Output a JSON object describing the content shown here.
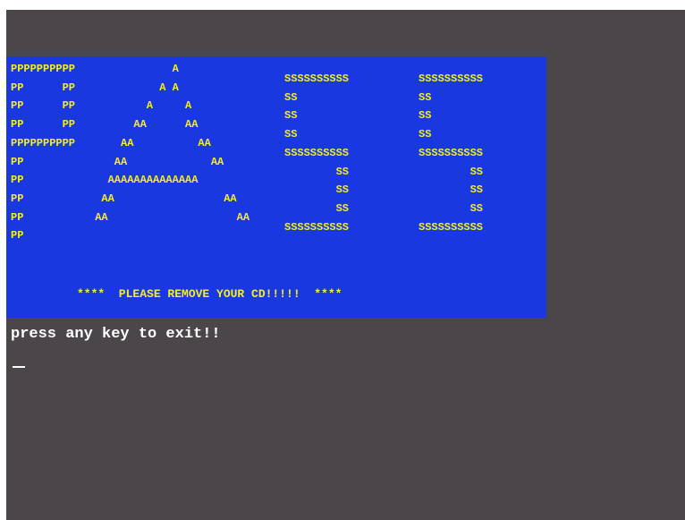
{
  "banner": {
    "letter_p": "PPPPPPPPPP\nPP      PP\nPP      PP\nPP      PP\nPPPPPPPPPP\nPP\nPP\nPP\nPP\nPP",
    "letter_a": "             A\n           A A\n         A     A\n       AA      AA\n     AA          AA\n    AA             AA\n   AAAAAAAAAAAAAA\n  AA                 AA\n AA                    AA",
    "letter_s1": "SSSSSSSSSS\nSS\nSS\nSS\nSSSSSSSSSS\n        SS\n        SS\n        SS\nSSSSSSSSSS",
    "letter_s2": "SSSSSSSSSS\nSS\nSS\nSS\nSSSSSSSSSS\n        SS\n        SS\n        SS\nSSSSSSSSSS",
    "message": "****  PLEASE REMOVE YOUR CD!!!!!  ****"
  },
  "console": {
    "prompt": "press any key to exit!!"
  },
  "colors": {
    "screen_bg": "#4a4649",
    "banner_bg": "#1a38e0",
    "banner_text": "#f5ee1e",
    "console_text": "#ffffff"
  }
}
